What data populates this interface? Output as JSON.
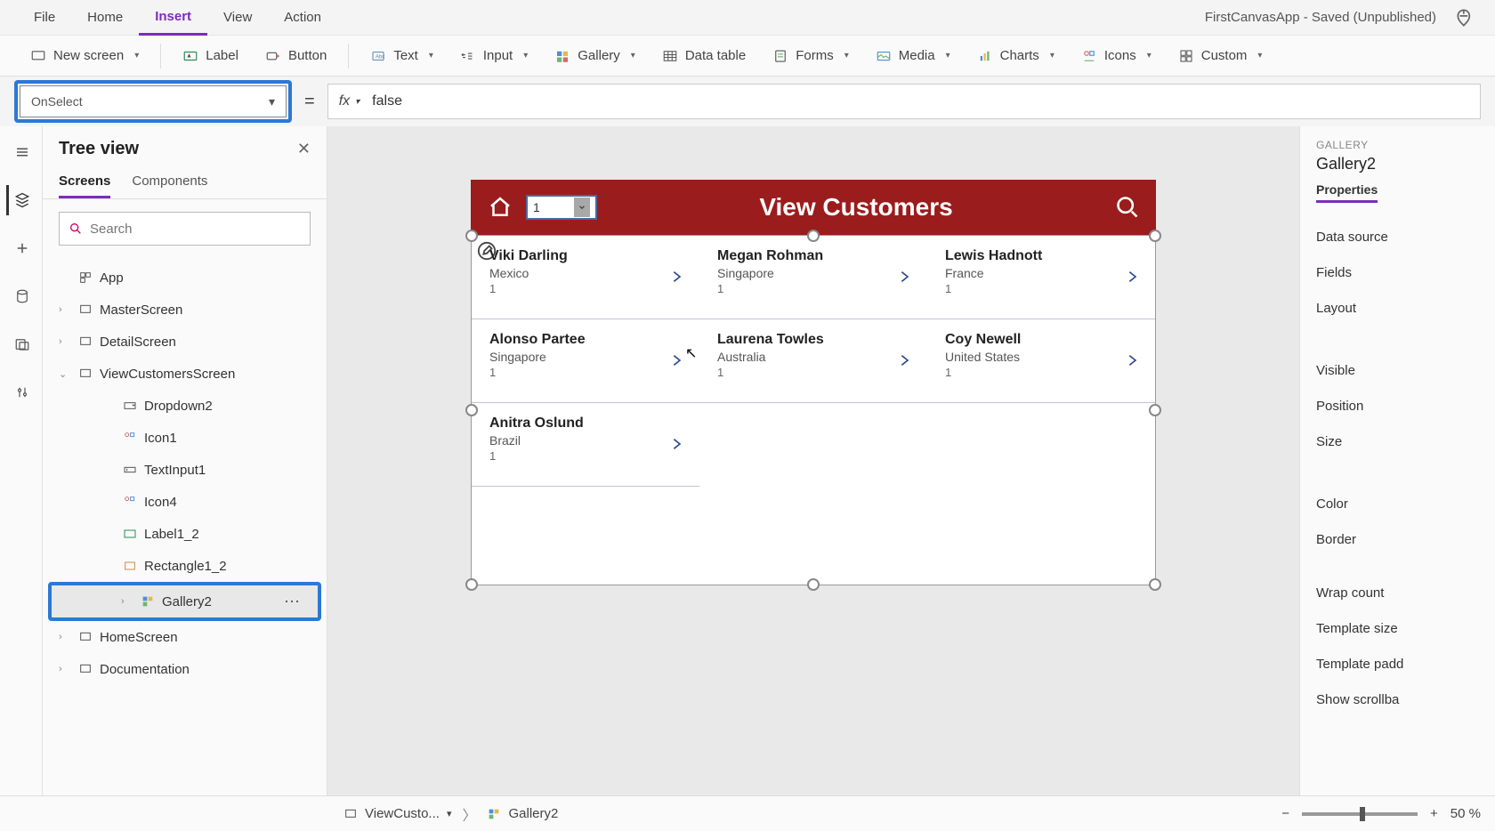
{
  "menubar": {
    "items": [
      "File",
      "Home",
      "Insert",
      "View",
      "Action"
    ],
    "active_index": 2,
    "app_title": "FirstCanvasApp - Saved (Unpublished)"
  },
  "ribbon": {
    "new_screen": "New screen",
    "label": "Label",
    "button": "Button",
    "text": "Text",
    "input": "Input",
    "gallery": "Gallery",
    "data_table": "Data table",
    "forms": "Forms",
    "media": "Media",
    "charts": "Charts",
    "icons": "Icons",
    "custom": "Custom"
  },
  "formula": {
    "property": "OnSelect",
    "value": "false"
  },
  "tree": {
    "title": "Tree view",
    "tabs": [
      "Screens",
      "Components"
    ],
    "active_tab": 0,
    "search_placeholder": "Search",
    "app_label": "App",
    "screens": [
      {
        "label": "MasterScreen",
        "expanded": false
      },
      {
        "label": "DetailScreen",
        "expanded": false
      },
      {
        "label": "ViewCustomersScreen",
        "expanded": true,
        "children": [
          {
            "label": "Dropdown2"
          },
          {
            "label": "Icon1"
          },
          {
            "label": "TextInput1"
          },
          {
            "label": "Icon4"
          },
          {
            "label": "Label1_2"
          },
          {
            "label": "Rectangle1_2"
          },
          {
            "label": "Gallery2",
            "selected": true
          }
        ]
      },
      {
        "label": "HomeScreen",
        "expanded": false
      },
      {
        "label": "Documentation",
        "expanded": false
      }
    ]
  },
  "canvas": {
    "header_title": "View Customers",
    "dropdown_value": "1",
    "customers": [
      {
        "name": "Viki  Darling",
        "country": "Mexico",
        "num": "1"
      },
      {
        "name": "Megan  Rohman",
        "country": "Singapore",
        "num": "1"
      },
      {
        "name": "Lewis  Hadnott",
        "country": "France",
        "num": "1"
      },
      {
        "name": "Alonso  Partee",
        "country": "Singapore",
        "num": "1"
      },
      {
        "name": "Laurena  Towles",
        "country": "Australia",
        "num": "1"
      },
      {
        "name": "Coy  Newell",
        "country": "United States",
        "num": "1"
      },
      {
        "name": "Anitra  Oslund",
        "country": "Brazil",
        "num": "1"
      }
    ]
  },
  "props": {
    "category": "GALLERY",
    "name": "Gallery2",
    "tab": "Properties",
    "rows": [
      "Data source",
      "Fields",
      "Layout",
      "Visible",
      "Position",
      "Size",
      "Color",
      "Border",
      "Wrap count",
      "Template size",
      "Template padd",
      "Show scrollba"
    ]
  },
  "statusbar": {
    "bc_screen": "ViewCusto...",
    "bc_element": "Gallery2",
    "zoom": "50  %"
  }
}
